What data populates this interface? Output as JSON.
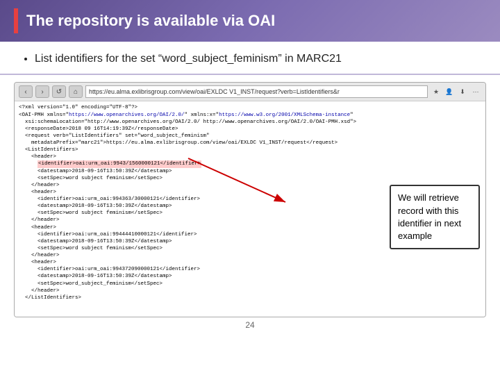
{
  "header": {
    "title": "The repository is available via OAI",
    "accent_color": "#e84040"
  },
  "bullet": {
    "text": "List identifiers for the set “word_subject_feminism” in MARC21"
  },
  "browser": {
    "url": "https://eu.alma.exlibrisgroup.com/view/oai/EXLDC V1_INST/request?verb=ListIdentifiers&r",
    "nav_buttons": [
      "<",
      ">",
      "↺",
      "⌂"
    ]
  },
  "xml": {
    "lines": [
      "<?xml version=\"1.0\" encoding=\"UTF-8\"?>",
      "<OAI-PMH xmlns=\"https://www.openarchives.org/OAI/2.0/\" xmlns:x=\"https://www.w3.org/2001/XMLSchema-Instance\"",
      "  xsi:schemaLocation=\"http://www.openarchives.org/OAI/2.0/ http://www.openarchives.org/OAI/2.0/OAI-PMH.xsd\">",
      "  <responseDate>2018 09 16T14:19:39Z</responseDate>",
      "  <request verb=\"ListIdentifiers\" set=\"word_subject_feminism\"",
      "    metadataPrefix=\"marc21\">https://eu.alma.exlibrisgroup.com/view/oai/EXLDC V1_INST/request</request>",
      "  <ListIdentifiers>",
      "    <header>",
      "      <identifier>oai:urm_oai:9943/1560000121</identifier>",
      "      <datestamp>2018-09-16T13:50:39Z</datestamp>",
      "      <setSpec>word subject feminism</setSpec>",
      "    </header>",
      "    <header>",
      "      <identifier>oai:urm_oai:994363/30000121</identifier>",
      "      <datestamp>2018-09-16T13:50:39Z</datestamp>",
      "      <setSpec>word subject feminism</setSpec>",
      "    </header>",
      "    <header>",
      "      <identifier>oai:urm_oai:99444410000121</identifier>",
      "      <datestamp>2018-09-16T13:50:39Z</datestamp>",
      "      <setSpec>word subject feminism</setSpec>",
      "    </header>",
      "    <header>",
      "      <identifier>oai:urm_oai:994372090000121</identifier>",
      "      <datestamp>2018-09-16T13:50:39Z</datestamp>",
      "      <setSpec>word_subject_feminism</setSpec>",
      "    </header>",
      "  </ListIdentifiers>"
    ],
    "highlighted_line": 8
  },
  "callout": {
    "text": "We will retrieve record with this identifier in next example"
  },
  "page_number": "24"
}
